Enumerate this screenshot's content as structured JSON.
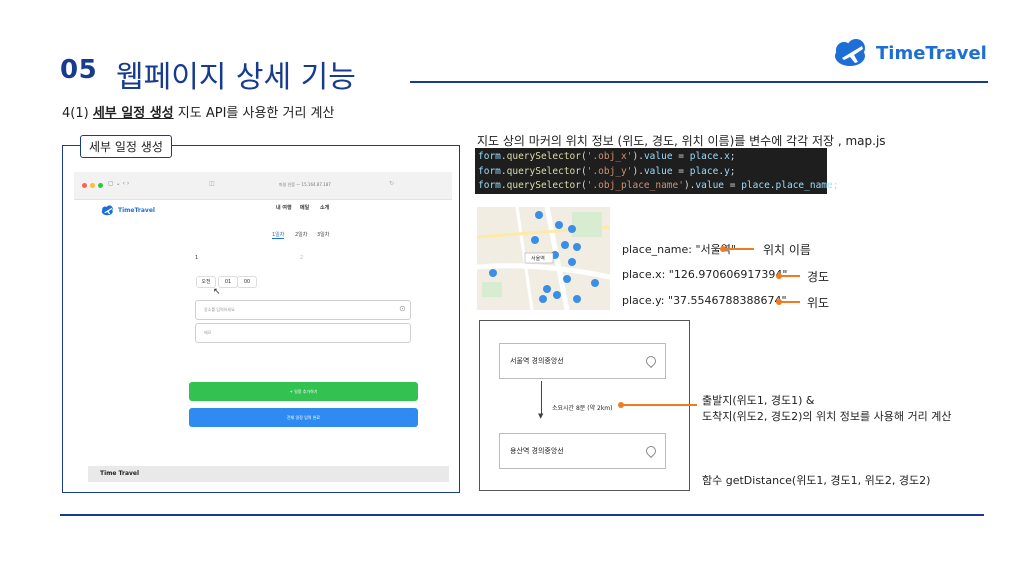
{
  "header": {
    "number": "05",
    "title": "웹페이지 상세 기능",
    "logo_text": "TimeTravel",
    "subtitle_prefix": "4(1)",
    "subtitle_bold": "세부 일정 생성",
    "subtitle_rest": "지도 API를 사용한 거리 계산"
  },
  "mockup": {
    "frame_label": "세부 일정 생성",
    "browser_url": "마일 인증 — 15.164.87.187",
    "logo_text": "TimeTravel",
    "nav": [
      "내 여행",
      "메일",
      "소개"
    ],
    "day_tabs": [
      "1일차",
      "2일차",
      "3일차"
    ],
    "num_left": "1",
    "num_right": "2",
    "time": [
      "오전",
      "01",
      "00"
    ],
    "place_placeholder": "장소를 입력하세요",
    "memo_placeholder": "메모",
    "add_button": "+ 일정 추가하기",
    "complete_button": "전체 일정 입력 완료",
    "footer": "Time Travel"
  },
  "code": {
    "title": "지도 상의 마커의 위치 정보 (위도, 경도, 위치 이름)를 변수에 각각 저장 , map.js",
    "lines": [
      {
        "var": "form",
        "fn": "querySelector",
        "sel": "'.obj_x'",
        "prop": "x"
      },
      {
        "var": "form",
        "fn": "querySelector",
        "sel": "'.obj_y'",
        "prop": "y"
      },
      {
        "var": "form",
        "fn": "querySelector",
        "sel": "'.obj_place_name'",
        "prop": "place_name"
      }
    ]
  },
  "map_info": {
    "place_name_text": "place_name: \"서울역\"",
    "place_name_label": "위치 이름",
    "x_text": "place.x: \"126.970606917394\"",
    "x_label": "경도",
    "y_text": "place.y: \"37.5546788388674\"",
    "y_label": "위도",
    "map_station_label": "서울역"
  },
  "route": {
    "from_station": "서울역 경의중앙선",
    "to_station": "용산역 경의중앙선",
    "duration": "소요시간 8분 (약 2km)",
    "desc_line1": "출발지(위도1, 경도1) &",
    "desc_line2": "도착지(위도2, 경도2)의 위치 정보를 사용해 거리 계산",
    "function_text": "함수 getDistance(위도1, 경도1, 위도2, 경도2)"
  },
  "colors": {
    "primary": "#173b8f",
    "accent_orange": "#f07b20",
    "green": "#33c251",
    "blue": "#2f8af2"
  }
}
